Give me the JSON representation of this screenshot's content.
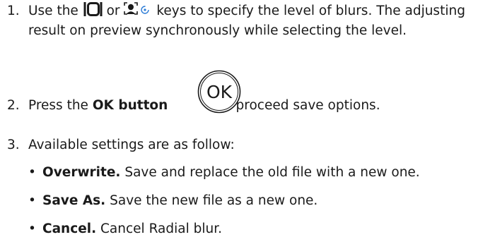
{
  "steps": [
    {
      "number": "1.",
      "text_before_icons": "Use the",
      "text_between_icons": "or",
      "text_after_icons": "keys to specify the level of blurs. The adjusting result on preview synchronously while selecting the level."
    },
    {
      "number": "2.",
      "text_before": "Press the",
      "bold": "OK button",
      "text_after": "to proceed save options.",
      "button_icon_label": "OK"
    },
    {
      "number": "3.",
      "text": "Available settings are as follow:"
    }
  ],
  "bullets": [
    {
      "bullet": "•",
      "bold": "Overwrite.",
      "text": "Save and replace the old file with a new one."
    },
    {
      "bullet": "•",
      "bold": "Save As.",
      "text": "Save the new file as a new one."
    },
    {
      "bullet": "•",
      "bold": "Cancel.",
      "text": "Cancel Radial blur."
    }
  ],
  "icons": {
    "screen_icon": "display-mode-icon",
    "face_icon": "face-detect-icon",
    "ok_icon": "ok-button-icon",
    "face_accent_color": "#2b7bd6"
  }
}
